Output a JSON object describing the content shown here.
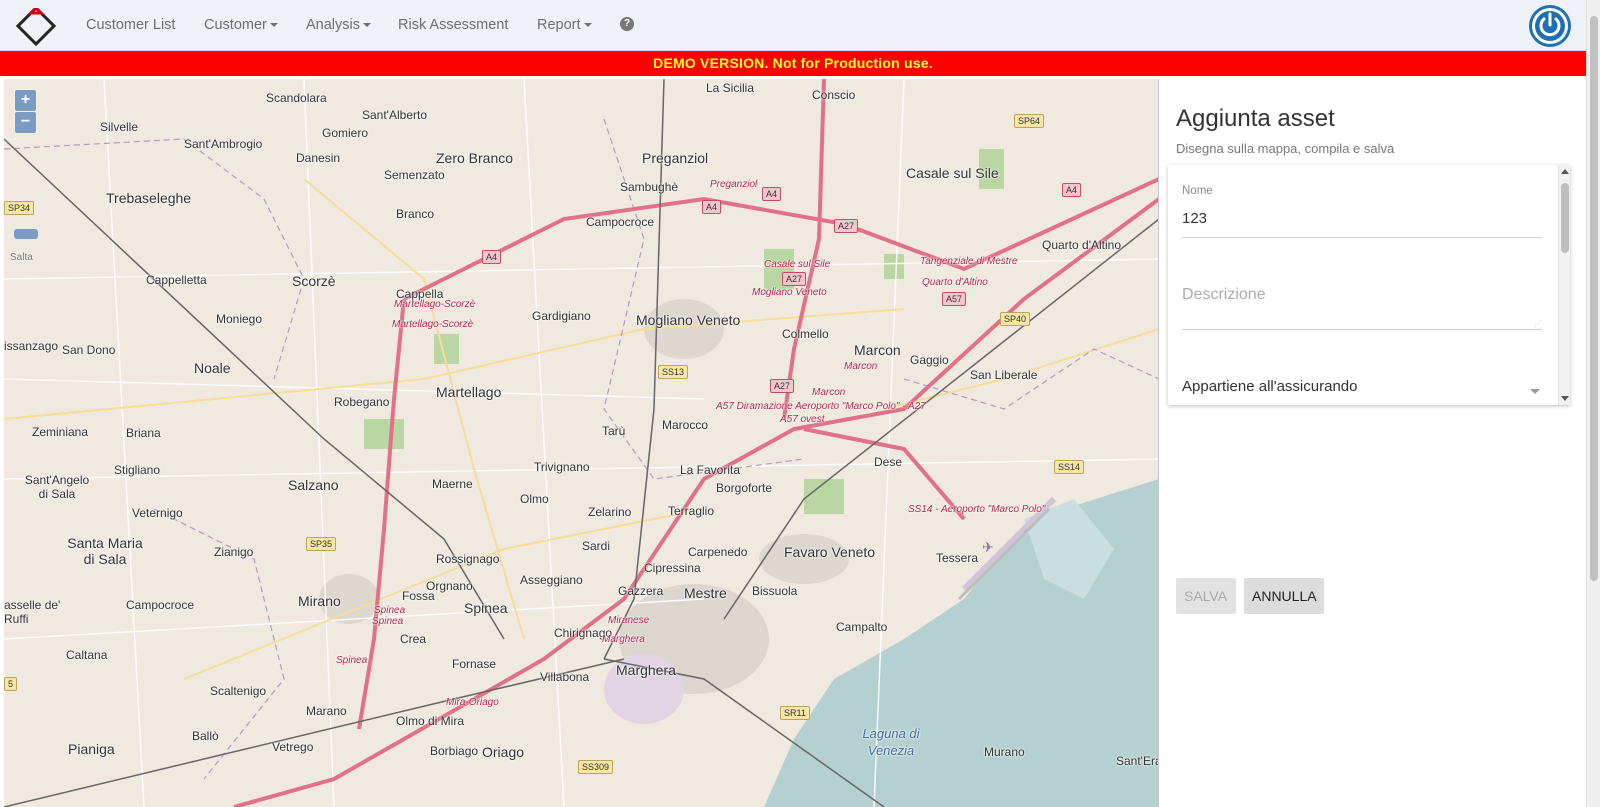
{
  "nav": {
    "items": [
      {
        "label": "Customer List",
        "dropdown": false
      },
      {
        "label": "Customer",
        "dropdown": true
      },
      {
        "label": "Analysis",
        "dropdown": true
      },
      {
        "label": "Risk Assessment",
        "dropdown": false
      },
      {
        "label": "Report",
        "dropdown": true
      }
    ],
    "help_icon": "question-circle-icon",
    "power_icon": "power-icon",
    "accent_color": "#1f6fb5"
  },
  "banner": {
    "text": "DEMO VERSION. Not for Production use.",
    "background": "#ff0000",
    "color": "#ffff33"
  },
  "map": {
    "zoom_in": "+",
    "zoom_out": "−",
    "places": [
      "Scandolara",
      "Sant'Alberto",
      "La Sicilia",
      "Conscio",
      "Silvelle",
      "Gomiero",
      "Sant'Ambrogio",
      "Danesin",
      "Zero Branco",
      "Preganziol",
      "Semenzato",
      "Sambughè",
      "Casale sul Sile",
      "Trebaseleghe",
      "Branco",
      "Campocroce",
      "Quarto d'Altino",
      "Cappelletta",
      "Scorzè",
      "Cappella",
      "Gardigiano",
      "Mogliano Veneto",
      "Moniego",
      "Colmello",
      "Marcon",
      "Gaggio",
      "San Liberale",
      "San Dono",
      "Noale",
      "Robegano",
      "Martellago",
      "Tarù",
      "Marocco",
      "Zeminiana",
      "Briana",
      "Dese",
      "Trivignano",
      "La Favorita",
      "Stigliano",
      "Salzano",
      "Maerne",
      "Olmo",
      "Borgoforte",
      "Sant'Angelo di Sala",
      "Veternigo",
      "Zelarino",
      "Terraglio",
      "Santa Maria di Sala",
      "Zianigo",
      "Sardi",
      "Carpenedo",
      "Favaro Veneto",
      "Tessera",
      "Rossignago",
      "Cipressina",
      "Mirano",
      "Fossa",
      "Orgnano",
      "Asseggiano",
      "Gazzera",
      "Mestre",
      "Bissuola",
      "Campocroce",
      "Spinea",
      "Crea",
      "Chirignago",
      "Campalto",
      "Caltana",
      "Fornase",
      "Marghera",
      "Villabona",
      "Scaltenigo",
      "Marano",
      "Olmo di Mira",
      "Ballò",
      "Vetrego",
      "Pianiga",
      "Borbiago",
      "Oriago",
      "Murano",
      "Sant'Eras",
      "Laguna di Venezia",
      "Salta",
      "issanzago",
      "asselle de' Ruffi"
    ],
    "roads": [
      "A4",
      "A27",
      "A57",
      "SS13",
      "SS14",
      "SP35",
      "SP40",
      "SP64",
      "SR11",
      "SS309",
      "SP34",
      "5"
    ],
    "road_labels": [
      "Preganziol",
      "Casale sul Sile",
      "Mogliano Veneto",
      "Tangenziale di Mestre",
      "Quarto d'Altino",
      "Martellago-Scorzè",
      "Martellago-Scorzè",
      "Marcon",
      "Marcon",
      "A57 Diramazione Aeroporto \"Marco Polo\" - A27",
      "A57 ovest",
      "SS14 - Aeroporto \"Marco Polo\"",
      "Spinea",
      "Spinea",
      "Spinea",
      "Miranese",
      "Marghera",
      "Mira-Oriago"
    ]
  },
  "panel": {
    "title": "Aggiunta asset",
    "subtitle": "Disegna sulla mappa, compila e salva",
    "fields": {
      "nome_label": "Nome",
      "nome_value": "123",
      "descrizione_placeholder": "Descrizione",
      "appartiene_label": "Appartiene all'assicurando"
    },
    "buttons": {
      "save": "SALVA",
      "cancel": "ANNULLA"
    }
  }
}
